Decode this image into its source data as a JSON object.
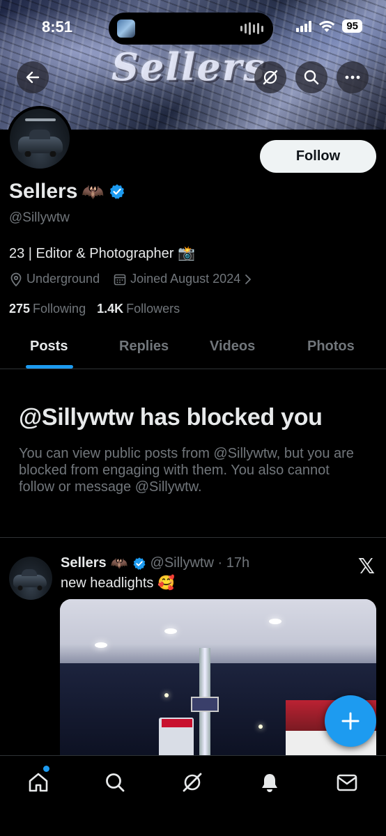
{
  "status_bar": {
    "time": "8:51",
    "battery": "95"
  },
  "banner": {
    "text": "Sellers"
  },
  "profile": {
    "display_name": "Sellers",
    "name_emoji": "🦇",
    "handle": "@Sillywtw",
    "follow_label": "Follow",
    "bio": "23 | Editor & Photographer 📸",
    "location": "Underground",
    "joined": "Joined August 2024",
    "following_count": "275",
    "following_label": "Following",
    "followers_count": "1.4K",
    "followers_label": "Followers"
  },
  "tabs": [
    {
      "label": "Posts",
      "active": true
    },
    {
      "label": "Replies",
      "active": false
    },
    {
      "label": "Videos",
      "active": false
    },
    {
      "label": "Photos",
      "active": false
    }
  ],
  "blocked": {
    "title": "@Sillywtw has blocked you",
    "body": "You can view public posts from @Sillywtw, but you are blocked from engaging with them. You also cannot follow or message @Sillywtw."
  },
  "post": {
    "name": "Sellers",
    "name_emoji": "🦇",
    "handle_time": "@Sillywtw · 17h",
    "text": "new headlights 🥰"
  },
  "colors": {
    "accent": "#1d9bf0",
    "muted": "#71767b",
    "text": "#e7e9ea",
    "background": "#000000"
  },
  "icons": [
    "back-arrow-icon",
    "grok-icon",
    "search-icon",
    "more-icon",
    "verified-badge-icon",
    "location-icon",
    "calendar-icon",
    "chevron-right-icon",
    "x-logo-icon",
    "compose-plus-icon",
    "home-icon",
    "notifications-icon",
    "messages-icon"
  ]
}
